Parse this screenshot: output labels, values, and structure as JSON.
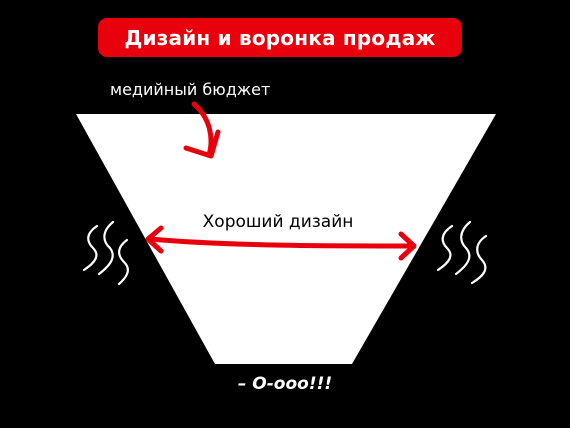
{
  "title": "Дизайн и воронка продаж",
  "labels": {
    "budget": "медийный бюджет",
    "good_design": "Хороший дизайн",
    "exclamation": "– О-ooo!!!"
  },
  "colors": {
    "background": "#000000",
    "accent": "#e8000d",
    "funnel_fill": "#ffffff",
    "text_light": "#ffffff",
    "text_dark": "#000000"
  },
  "icons": {
    "wave_left": "wavy-lines-icon",
    "wave_right": "wavy-lines-icon"
  }
}
